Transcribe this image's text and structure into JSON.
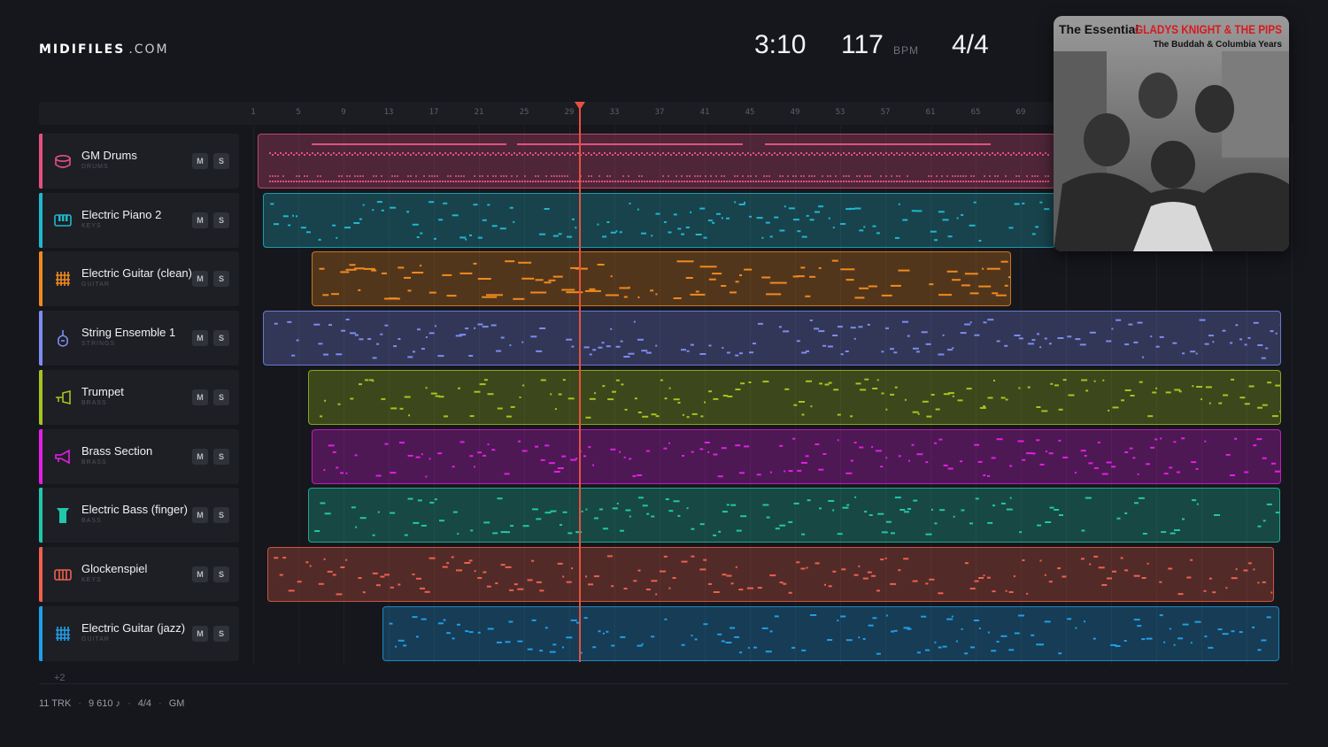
{
  "brand": {
    "name": "MIDIFILES",
    "domain": ".COM"
  },
  "stats": {
    "duration": "3:10",
    "tempo": "117",
    "tempo_unit": "BPM",
    "time_signature": "4/4"
  },
  "album": {
    "title_prefix": "The Essential",
    "title_artist": "GLADYS KNIGHT & THE PIPS",
    "subtitle": "The Buddah & Columbia Years"
  },
  "ruler": {
    "ticks": [
      "1",
      "5",
      "9",
      "13",
      "17",
      "21",
      "25",
      "29",
      "33",
      "37",
      "41",
      "45",
      "49",
      "53",
      "57",
      "61",
      "65",
      "69"
    ]
  },
  "playhead_position": "29",
  "tracks": [
    {
      "name": "GM Drums",
      "category": "DRUMS",
      "color": "#e4507f",
      "icon": "drum-icon",
      "mute": "M",
      "solo": "S"
    },
    {
      "name": "Electric Piano 2",
      "category": "KEYS",
      "color": "#1fb8cc",
      "icon": "piano-icon",
      "mute": "M",
      "solo": "S"
    },
    {
      "name": "Electric Guitar (clean)",
      "category": "GUITAR",
      "color": "#f08a1e",
      "icon": "guitar-icon",
      "mute": "M",
      "solo": "S"
    },
    {
      "name": "String Ensemble 1",
      "category": "STRINGS",
      "color": "#7d8cf0",
      "icon": "violin-icon",
      "mute": "M",
      "solo": "S"
    },
    {
      "name": "Trumpet",
      "category": "BRASS",
      "color": "#a6c41e",
      "icon": "trumpet-icon",
      "mute": "M",
      "solo": "S"
    },
    {
      "name": "Brass Section",
      "category": "BRASS",
      "color": "#e41ee6",
      "icon": "horn-icon",
      "mute": "M",
      "solo": "S"
    },
    {
      "name": "Electric Bass (finger)",
      "category": "BASS",
      "color": "#1fc8aa",
      "icon": "bass-icon",
      "mute": "M",
      "solo": "S"
    },
    {
      "name": "Glockenspiel",
      "category": "KEYS",
      "color": "#f0604c",
      "icon": "glockenspiel-icon",
      "mute": "M",
      "solo": "S"
    },
    {
      "name": "Electric Guitar (jazz)",
      "category": "GUITAR",
      "color": "#1e9fe8",
      "icon": "guitar-icon",
      "mute": "M",
      "solo": "S"
    }
  ],
  "more_tracks": "+2",
  "footer": {
    "tracks": "11 TRK",
    "notes": "9 610 ♪",
    "time_signature": "4/4",
    "standard": "GM"
  }
}
